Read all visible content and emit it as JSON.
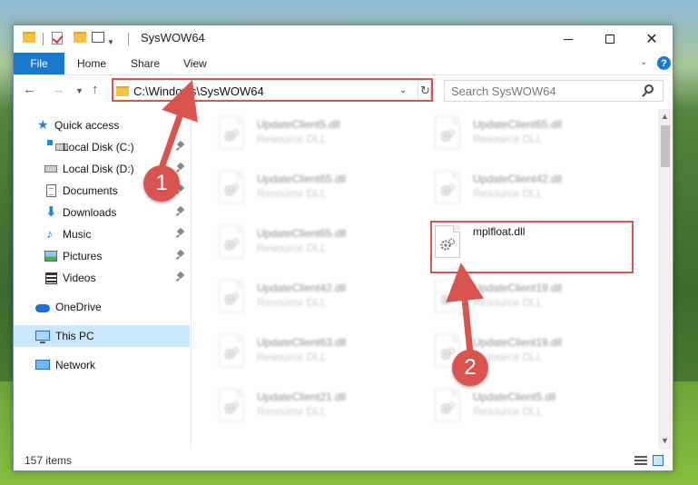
{
  "window": {
    "title": "SysWOW64"
  },
  "ribbon": {
    "tabs": [
      "File",
      "Home",
      "Share",
      "View"
    ]
  },
  "nav": {
    "address": "C:\\Windows\\SysWOW64",
    "search_placeholder": "Search SysWOW64"
  },
  "sidebar": {
    "items": [
      {
        "label": "Quick access",
        "icon": "star-icon"
      },
      {
        "label": "Local Disk (C:)",
        "icon": "drive-icon"
      },
      {
        "label": "Local Disk (D:)",
        "icon": "drive-icon"
      },
      {
        "label": "Documents",
        "icon": "documents-icon"
      },
      {
        "label": "Downloads",
        "icon": "downloads-icon"
      },
      {
        "label": "Music",
        "icon": "music-icon"
      },
      {
        "label": "Pictures",
        "icon": "pictures-icon"
      },
      {
        "label": "Videos",
        "icon": "videos-icon"
      },
      {
        "label": "OneDrive",
        "icon": "cloud-icon"
      },
      {
        "label": "This PC",
        "icon": "computer-icon"
      },
      {
        "label": "Network",
        "icon": "network-icon"
      }
    ]
  },
  "files": {
    "col1": [
      {
        "name": "UpdateClient5.dll",
        "type": "Resource DLL"
      },
      {
        "name": "UpdateClient65.dll",
        "type": "Resource DLL"
      },
      {
        "name": "UpdateClient65.dll",
        "type": "Resource DLL"
      },
      {
        "name": "UpdateClient42.dll",
        "type": "Resource DLL"
      },
      {
        "name": "UpdateClient63.dll",
        "type": "Resource DLL"
      },
      {
        "name": "UpdateClient21.dll",
        "type": "Resource DLL"
      }
    ],
    "col2": [
      {
        "name": "UpdateClient65.dll",
        "type": "Resource DLL"
      },
      {
        "name": "UpdateClient42.dll",
        "type": "Resource DLL"
      },
      {
        "name": "mplfloat.dll",
        "type": ""
      },
      {
        "name": "UpdateClient19.dll",
        "type": "Resource DLL"
      },
      {
        "name": "UpdateClient19.dll",
        "type": "Resource DLL"
      },
      {
        "name": "UpdateClient5.dll",
        "type": "Resource DLL"
      }
    ]
  },
  "status": {
    "item_count": "157 items"
  },
  "annotations": {
    "badge1": "1",
    "badge2": "2",
    "color": "#d9534f"
  }
}
